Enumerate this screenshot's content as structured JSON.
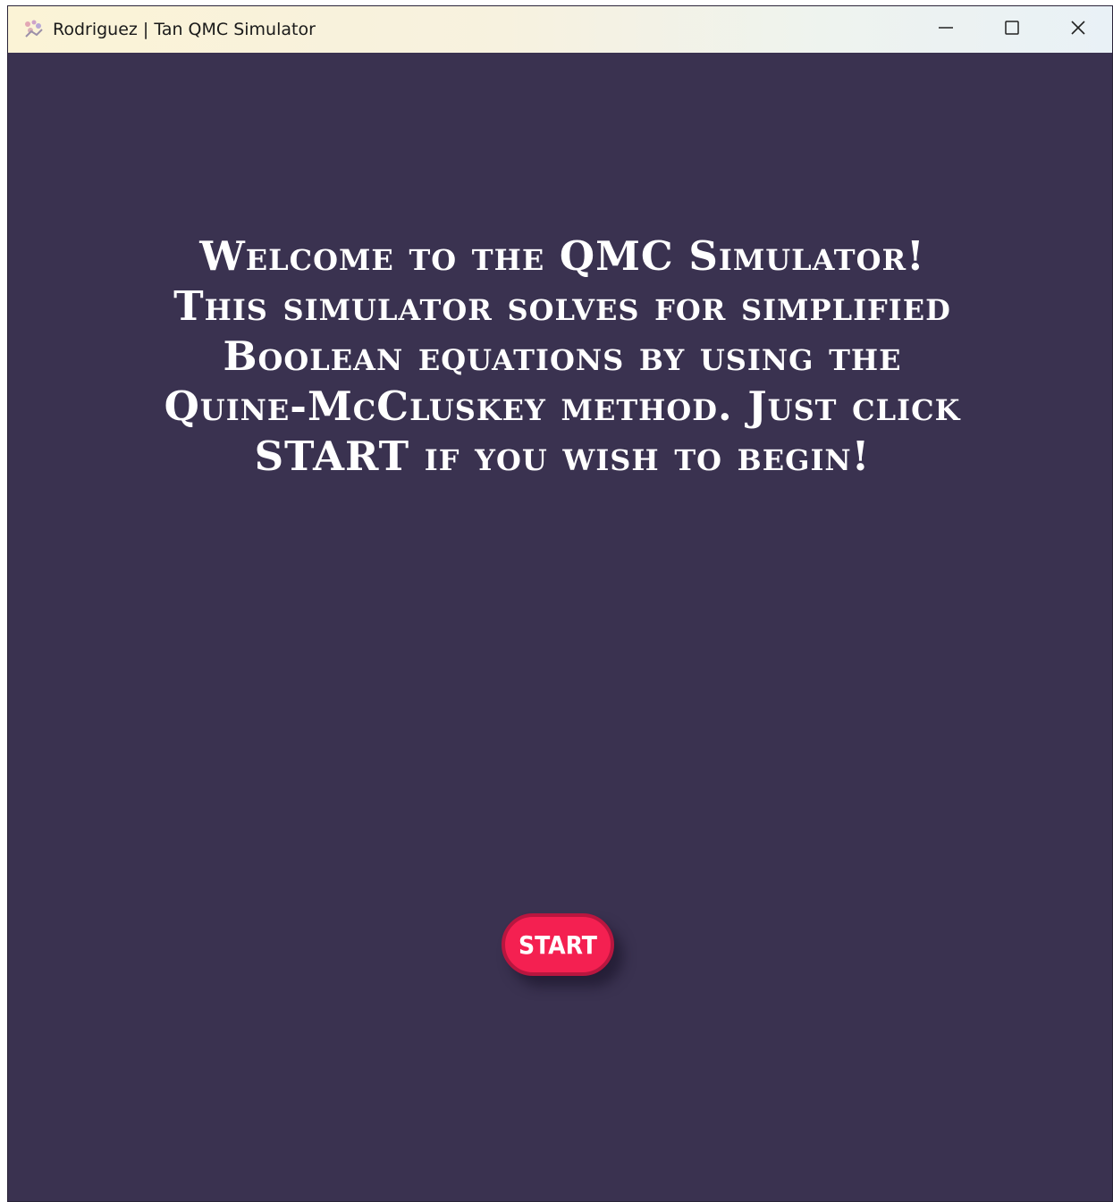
{
  "window": {
    "title": "Rodriguez | Tan QMC Simulator",
    "app_icon": "app-logo-icon",
    "controls": {
      "minimize_icon": "minimize-icon",
      "maximize_icon": "maximize-icon",
      "close_icon": "close-icon"
    }
  },
  "main": {
    "welcome_text": "Welcome to the QMC Simulator! This simulator solves for simplified Boolean equations by using the Quine-McCluskey method. Just click START if you wish to begin!",
    "start_label": "START"
  },
  "colors": {
    "background": "#3a3250",
    "text": "#ffffff",
    "accent": "#f42051",
    "accent_border": "#b8163f"
  }
}
